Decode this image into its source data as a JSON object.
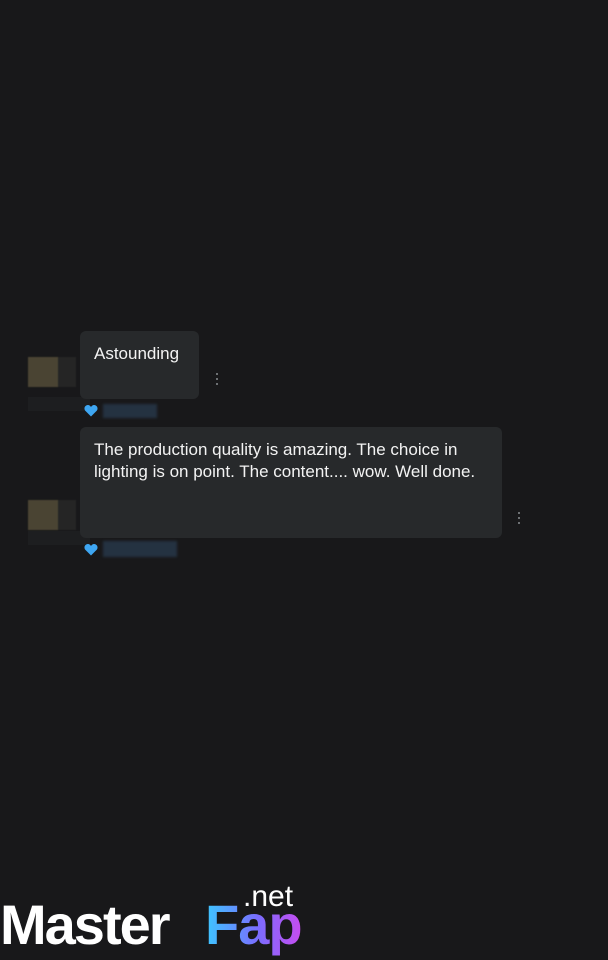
{
  "comments": [
    {
      "text": "Astounding"
    },
    {
      "text": "The production quality is amazing. The choice in lighting is on point. The content.... wow. Well done."
    }
  ],
  "icons": {
    "like": "heart-icon",
    "more": "vertical-dots-icon"
  },
  "colors": {
    "background": "#18181a",
    "bubble": "#27292b",
    "heart": "#3ea6f2"
  },
  "watermark": {
    "part1": "Master",
    "part2": "Fap",
    "part3": ".net"
  }
}
